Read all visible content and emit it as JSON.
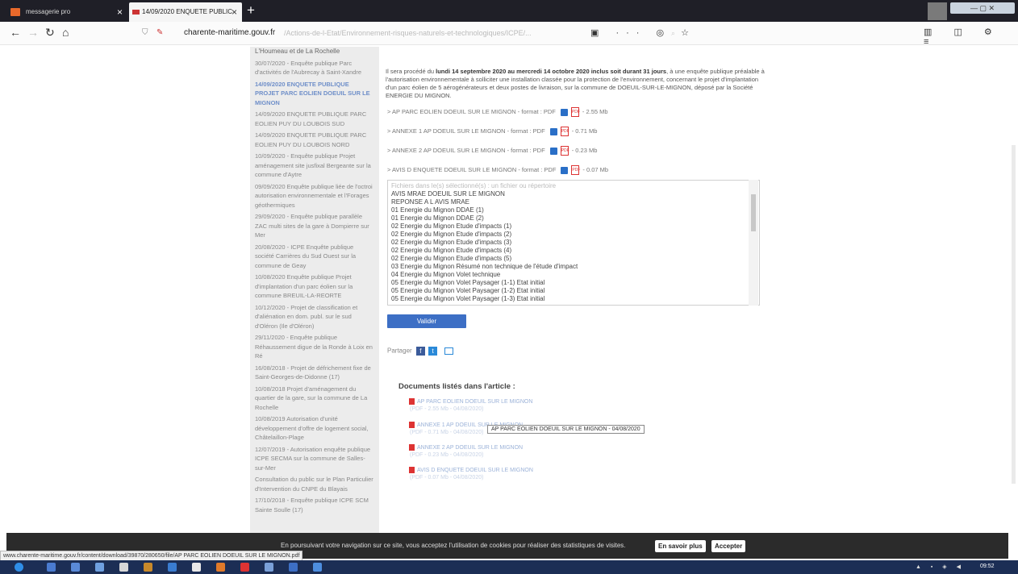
{
  "browser": {
    "tabs": [
      {
        "label": "messagerie pro"
      },
      {
        "label": "14/09/2020 ENQUETE PUBLIC"
      }
    ],
    "url_host": "charente-maritime.gouv.fr",
    "url_path": "/Actions-de-l-Etat/Environnement-risques-naturels-et-technologiques/ICPE/..."
  },
  "sidebar": {
    "items": [
      {
        "text": "L'Houmeau et de La Rochelle",
        "active": false
      },
      {
        "text": "30/07/2020 - Enquête publique Parc d'activités de l'Aubrecay à Saint-Xandre",
        "active": false
      },
      {
        "text": "14/09/2020 ENQUETE PUBLIQUE PROJET PARC EOLIEN DOEUIL SUR LE MIGNON",
        "active": true
      },
      {
        "text": "14/09/2020 ENQUETE PUBLIQUE PARC EOLIEN PUY DU LOUBOIS SUD",
        "active": false
      },
      {
        "text": "14/09/2020 ENQUETE PUBLIQUE PARC EOLIEN PUY DU LOUBOIS NORD",
        "active": false
      },
      {
        "text": "10/09/2020 - Enquête publique Projet aménagement site jusfixal Bergeante sur la commune d'Aytre",
        "active": false
      },
      {
        "text": "09/09/2020 Enquête publique liée de l'octroi autorisation environnementale et l'Forages géothermiques",
        "active": false
      },
      {
        "text": "29/09/2020 - Enquête publique parallèle ZAC multi sites de la gare à Dompierre sur Mer",
        "active": false
      },
      {
        "text": "20/08/2020 - ICPE Enquête publique société Carrières du Sud Ouest sur la commune de Geay",
        "active": false
      },
      {
        "text": "10/08/2020 Enquête publique Projet d'implantation d'un parc éolien sur la commune BREUIL-LA-REORTE",
        "active": false
      },
      {
        "text": "10/12/2020 - Projet de classification et d'aliénation en dom. publ. sur le sud d'Oléron (Ile d'Oléron)",
        "active": false
      },
      {
        "text": "29/11/2020 - Enquête publique Réhaussement digue de la Ronde à Loix en Ré",
        "active": false
      },
      {
        "text": "16/08/2018 - Projet de défrichement fixe de Saint-Georges-de-Didonne (17)",
        "active": false
      },
      {
        "text": "10/08/2018 Projet d'aménagement du quartier de la gare, sur la commune de La Rochelle",
        "active": false
      },
      {
        "text": "10/08/2019 Autorisation d'unité développement d'offre de logement social, Châtelaillon-Plage",
        "active": false
      },
      {
        "text": "12/07/2019 - Autorisation enquête publique ICPE SECMA sur la commune de Salles-sur-Mer",
        "active": false
      },
      {
        "text": "Consultation du public sur le Plan Particulier d'Intervention du CNPE du Blayais",
        "active": false
      },
      {
        "text": "17/10/2018 - Enquête publique ICPE SCM Sainte Soulle (17)",
        "active": false
      }
    ]
  },
  "article": {
    "intro_a": "Il sera procédé du ",
    "intro_bold1": "lundi 14 septembre 2020 au mercredi 14 octobre 2020 inclus soit durant 31 jours",
    "intro_b": ", à une enquête publique préalable à l'autorisation environnementale à solliciter une installation classée pour la protection de l'environnement, concernant le projet d'implantation d'un parc éolien de 5 aérogénérateurs et deux postes de livraison, sur la commune de DOEUIL-SUR-LE-MIGNON, déposé par la Société ENERGIE DU MIGNON.",
    "docs": [
      {
        "label": "> AP PARC EOLIEN DOEUIL SUR LE MIGNON - format : PDF",
        "size": "- 2.55 Mb"
      },
      {
        "label": "> ANNEXE 1 AP DOEUIL SUR LE MIGNON - format : PDF",
        "size": "- 0.71 Mb"
      },
      {
        "label": "> ANNEXE 2 AP DOEUIL SUR LE MIGNON - format : PDF",
        "size": "- 0.23 Mb"
      },
      {
        "label": "> AVIS D ENQUETE DOEUIL SUR LE MIGNON - format : PDF",
        "size": "- 0.07 Mb"
      }
    ],
    "file_list": [
      "Fichiers dans le(s) sélectionné(s) : un fichier ou répertoire",
      "AVIS MRAE DOEUIL SUR LE MIGNON",
      "REPONSE A L AVIS MRAE",
      "01 Energie du Mignon DDAE (1)",
      "01 Energie du Mignon DDAE (2)",
      "02 Energie du Mignon Etude d'impacts (1)",
      "02 Energie du Mignon Etude d'impacts (2)",
      "02 Energie du Mignon Etude d'impacts (3)",
      "02 Energie du Mignon Etude d'impacts (4)",
      "02 Energie du Mignon Etude d'impacts (5)",
      "03 Energie du Mignon Résumé non technique de l'étude d'impact",
      "04 Energie du Mignon Volet technique",
      "05 Energie du Mignon Volet Paysager (1-1) Etat initial",
      "05 Energie du Mignon Volet Paysager (1-2) Etat initial",
      "05 Energie du Mignon Volet Paysager (1-3) Etat initial"
    ],
    "validate_label": "Valider",
    "share_label": "Partager",
    "docs_title": "Documents listés dans l'article :",
    "listed_docs": [
      {
        "title": "AP PARC EOLIEN DOEUIL SUR LE MIGNON",
        "meta": "(PDF - 2.55 Mb - 04/08/2020)"
      },
      {
        "title": "ANNEXE 1 AP DOEUIL SUR LE MIGNON",
        "meta": "(PDF - 0.71 Mb - 04/08/2020)"
      },
      {
        "title": "ANNEXE 2 AP DOEUIL SUR LE MIGNON",
        "meta": "(PDF - 0.23 Mb - 04/08/2020)"
      },
      {
        "title": "AVIS D ENQUETE DOEUIL SUR LE MIGNON",
        "meta": "(PDF - 0.07 Mb - 04/08/2020)"
      }
    ],
    "tooltip": "AP PARC EOLIEN DOEUIL SUR LE MIGNON - 04/08/2020"
  },
  "cookie": {
    "text": "En poursuivant votre navigation sur ce site, vous acceptez l'utilisation de cookies pour réaliser des statistiques de visites.",
    "more_label": "En savoir plus",
    "accept_label": "Accepter"
  },
  "status_url": "www.charente-maritime.gouv.fr/content/download/39870/280650/file/AP PARC EOLIEN DOEUIL SUR LE MIGNON.pdf",
  "taskbar": {
    "clock": "09:52"
  },
  "colors": {
    "accent": "#3d6fc5",
    "cookie_bg": "#2b2b2b",
    "sidebar_bg": "#ececec",
    "taskbar": "#1c2e55"
  }
}
